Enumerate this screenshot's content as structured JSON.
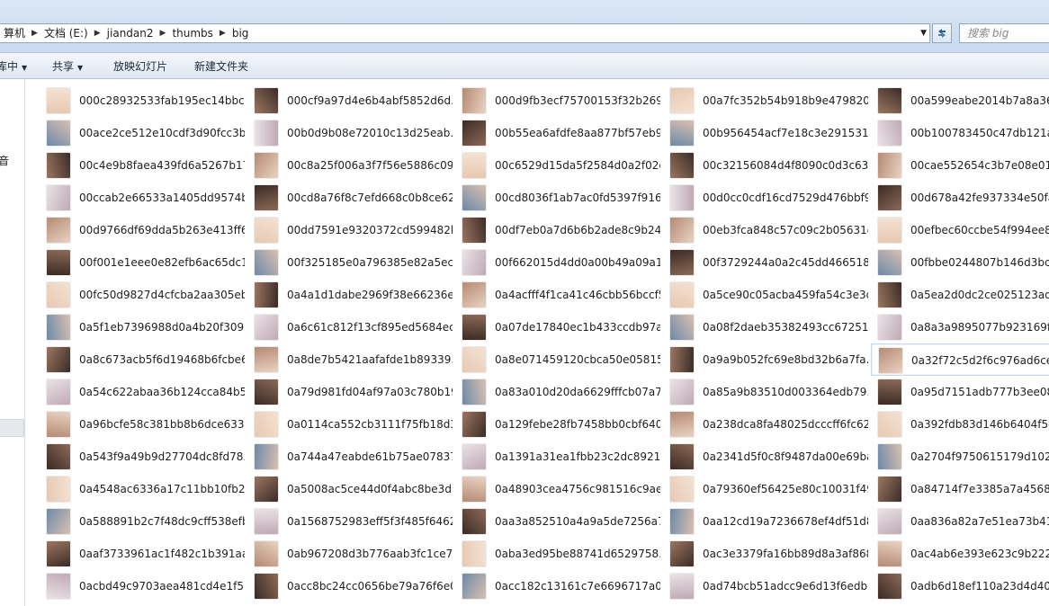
{
  "address": {
    "crumbs": [
      "算机",
      "文档 (E:)",
      "jiandan2",
      "thumbs",
      "big"
    ]
  },
  "search": {
    "placeholder": "搜索 big"
  },
  "toolbar": {
    "organize_label": "库中",
    "share_label": "共享",
    "slideshow_label": "放映幻灯片",
    "new_folder_label": "新建文件夹"
  },
  "nav": {
    "fragment_label": "音"
  },
  "icons": {
    "crumb_separator": "chevron-right-icon",
    "address_dropdown": "chevron-down-icon",
    "refresh": "refresh-icon"
  },
  "files": [
    [
      "000c28932533fab195ec14bbc...",
      "000cf9a97d4e6b4abf5852d6d...",
      "000d9fb3ecf75700153f32b269...",
      "00a7fc352b54b918b9e479820...",
      "00a599eabe2014b7a8a364d"
    ],
    [
      "00ace2ce512e10cdf3d90fcc3b...",
      "00b0d9b08e72010c13d25eab...",
      "00b55ea6afdfe8aa877bf57eb9...",
      "00b956454acf7e18c3e2915316...",
      "00b100783450c47db121a7f"
    ],
    [
      "00c4e9b8faea439fd6a5267b17...",
      "00c8a25f006a3f7f56e5886c09f...",
      "00c6529d15da5f2584d0a2f02c...",
      "00c32156084d4f8090c0d3c63f...",
      "00cae552654c3b7e08e0102t"
    ],
    [
      "00ccab2e66533a1405dd9574b...",
      "00cd8a76f8c7efd668c0b8ce62...",
      "00cd8036f1ab7ac0fd5397f916f...",
      "00d0cc0cdf16cd7529d476bbf9...",
      "00d678a42fe937334e50fa7c"
    ],
    [
      "00d9766df69dda5b263e413ff6...",
      "00dd7591e9320372cd599482b...",
      "00df7eb0a7d6b6b2ade8c9b24...",
      "00eb3fca848c57c09c2b05631d...",
      "00efbec60ccbe54f994ee812"
    ],
    [
      "00f001e1eee0e82efb6ac65dc1...",
      "00f325185e0a796385e82a5ec2...",
      "00f662015d4dd0a00b49a09a1...",
      "00f3729244a0a2c45dd466518...",
      "00fbbe0244807b146d3bcb6"
    ],
    [
      "00fc50d9827d4cfcba2aa305eb...",
      "0a4a1d1dabe2969f38e66236e...",
      "0a4acfff4f1ca41c46cbb56bccf5...",
      "0a5ce90c05acba459fa54c3e3d...",
      "0a5ea2d0dc2ce025123ad83"
    ],
    [
      "0a5f1eb7396988d0a4b20f309...",
      "0a6c61c812f13cf895ed5684ec...",
      "0a07de17840ec1b433ccdb97a...",
      "0a08f2daeb35382493cc67251...",
      "0a8a3a9895077b923169f382"
    ],
    [
      "0a8c673acb5f6d19468b6fcbe6...",
      "0a8de7b5421aafafde1b89339...",
      "0a8e071459120cbca50e05815...",
      "0a9a9b052fc69e8bd32b6a7fa...",
      "0a32f72c5d2f6c976ad6cef5b"
    ],
    [
      "0a54c622abaa36b124cca84b5...",
      "0a79d981fd04af97a03c780b19...",
      "0a83a010d20da6629fffcb07a7...",
      "0a85a9b83510d003364edb79...",
      "0a95d7151adb777b3ee0832"
    ],
    [
      "0a96bcfe58c381bb8b6dce633...",
      "0a0114ca552cb3111f75fb18d3...",
      "0a129febe28fb7458bb0cbf640...",
      "0a238dca8fa48025dcccff6fc62...",
      "0a392fdb83d146b6404f5dd"
    ],
    [
      "0a543f9a49b9d27704dc8fd78...",
      "0a744a47eabde61b75ae07837...",
      "0a1391a31ea1fbb23c2dc8921...",
      "0a2341d5f0c8f9487da00e69ba...",
      "0a2704f9750615179d102414"
    ],
    [
      "0a4548ac6336a17c11bb10fb2...",
      "0a5008ac5ce44d0f4abc8be3d...",
      "0a48903cea4756c981516c9ae...",
      "0a79360ef56425e80c10031f49...",
      "0a84714f7e3385a7a4568ebe"
    ],
    [
      "0a588891b2c7f48dc9cff538efb...",
      "0a1568752983eff5f3f485f6462f...",
      "0aa3a852510a4a9a5de7256a7...",
      "0aa12cd19a7236678ef4df51d8...",
      "0aa836a82a7e51ea73b4163"
    ],
    [
      "0aaf3733961ac1f482c1b391aa...",
      "0ab967208d3b776aab3fc1ce7...",
      "0aba3ed95be88741d6529758...",
      "0ac3e3379fa16bb89d8a3af868...",
      "0ac4ab6e393e623c9b222292"
    ],
    [
      "0acbd49c9703aea481cd4e1f5...",
      "0acc8bc24cc0656be79a76f6e0...",
      "0acc182c13161c7e6696717a07...",
      "0ad74bcb51adcc9e6d13f6edb...",
      "0adb6d18ef110a23d4d40d2"
    ]
  ]
}
